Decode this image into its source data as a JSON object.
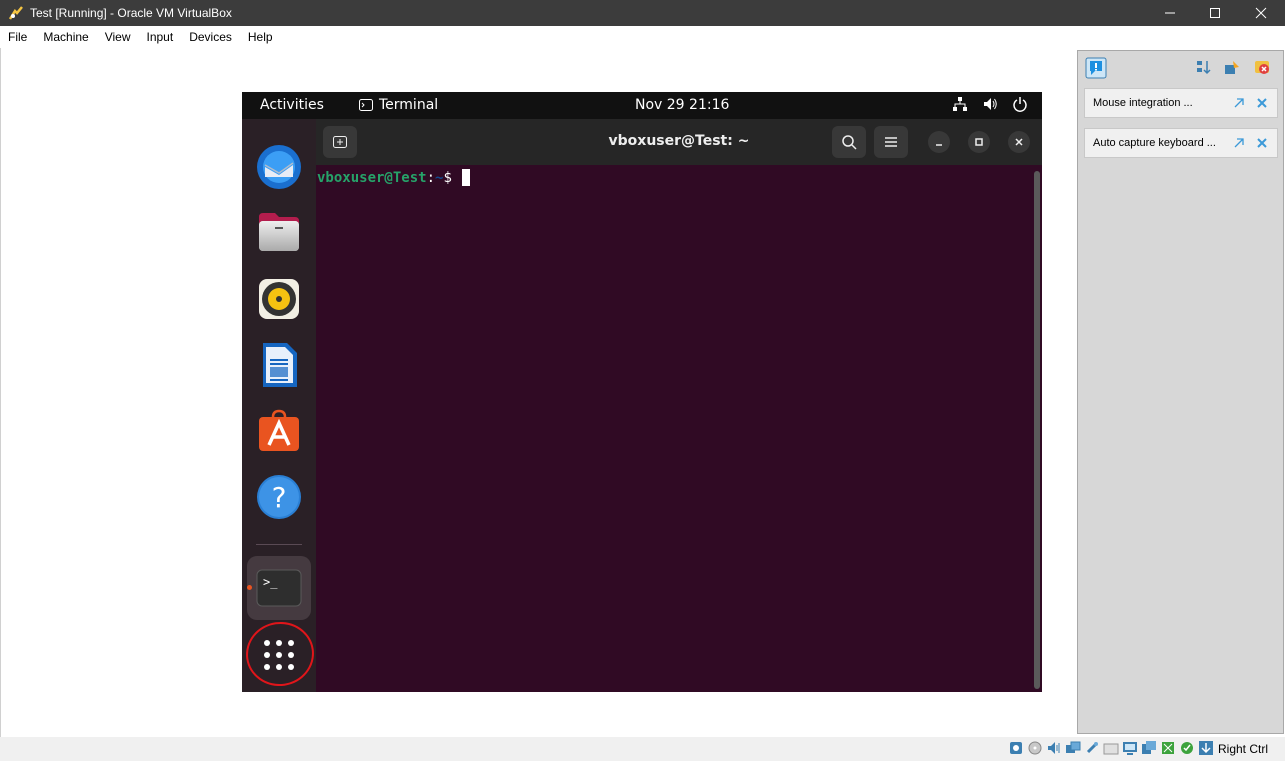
{
  "window": {
    "title": "Test [Running] - Oracle VM VirtualBox"
  },
  "menubar": [
    "File",
    "Machine",
    "View",
    "Input",
    "Devices",
    "Help"
  ],
  "guest": {
    "topbar": {
      "activities": "Activities",
      "app_name": "Terminal",
      "clock": "Nov 29  21:16"
    },
    "dock": [
      "thunderbird-icon",
      "files-icon",
      "rhythmbox-icon",
      "libreoffice-writer-icon",
      "ubuntu-software-icon",
      "help-icon",
      "terminal-icon",
      "show-apps-icon"
    ],
    "terminal": {
      "title": "vboxuser@Test: ~",
      "prompt_user": "vboxuser@Test",
      "prompt_sep": ":",
      "prompt_path": "~",
      "prompt_symbol": "$ "
    }
  },
  "notifications": [
    {
      "text": "Mouse integration ..."
    },
    {
      "text": "Auto capture keyboard ..."
    }
  ],
  "statusbar": {
    "host_key": "Right Ctrl"
  },
  "colors": {
    "terminal_bg": "#300a24",
    "prompt_user": "#26a269",
    "accent": "#e95420"
  }
}
